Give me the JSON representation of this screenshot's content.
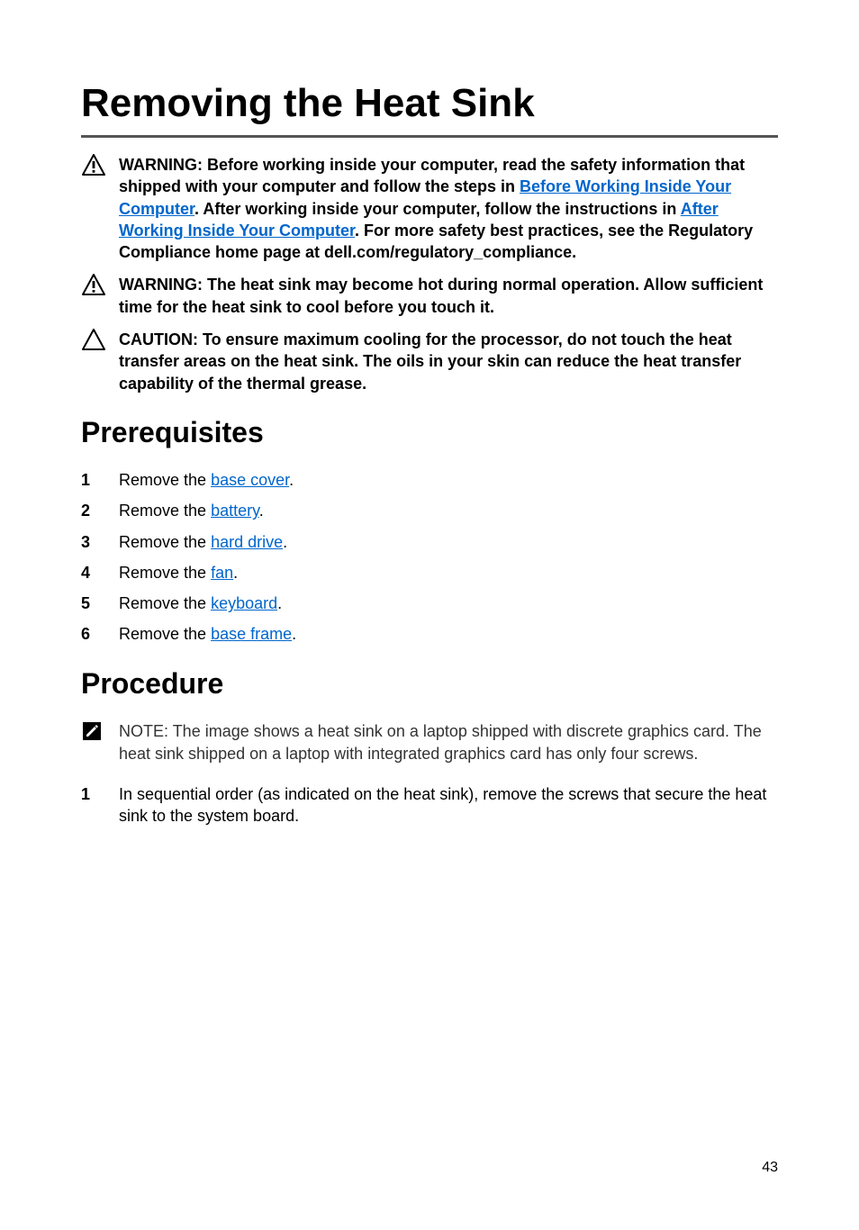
{
  "title": "Removing the Heat Sink",
  "warnings": {
    "w1_pre": "WARNING: Before working inside your computer, read the safety information that shipped with your computer and follow the steps in ",
    "w1_link1": "Before Working Inside Your Computer",
    "w1_mid1": ". After working inside your computer, follow the instructions in ",
    "w1_link2": "After Working Inside Your Computer",
    "w1_post": ". For more safety best practices, see the Regulatory Compliance home page at dell.com/regulatory_compliance.",
    "w2": "WARNING: The heat sink may become hot during normal operation. Allow sufficient time for the heat sink to cool before you touch it.",
    "c1": "CAUTION: To ensure maximum cooling for the processor, do not touch the heat transfer areas on the heat sink. The oils in your skin can reduce the heat transfer capability of the thermal grease."
  },
  "sections": {
    "prereq_title": "Prerequisites",
    "procedure_title": "Procedure"
  },
  "prereq": {
    "lead": "Remove the ",
    "items": [
      {
        "num": "1",
        "link": "base cover"
      },
      {
        "num": "2",
        "link": "battery"
      },
      {
        "num": "3",
        "link": "hard drive"
      },
      {
        "num": "4",
        "link": "fan"
      },
      {
        "num": "5",
        "link": "keyboard"
      },
      {
        "num": "6",
        "link": "base frame"
      }
    ]
  },
  "note": {
    "label": "NOTE: ",
    "text": "The image shows a heat sink on a laptop shipped with discrete graphics card. The heat sink shipped on a laptop with integrated graphics card has only four screws."
  },
  "procedure": {
    "items": [
      {
        "num": "1",
        "text": "In sequential order (as indicated on the heat sink), remove the screws that secure the heat sink to the system board."
      }
    ]
  },
  "page_number": "43"
}
